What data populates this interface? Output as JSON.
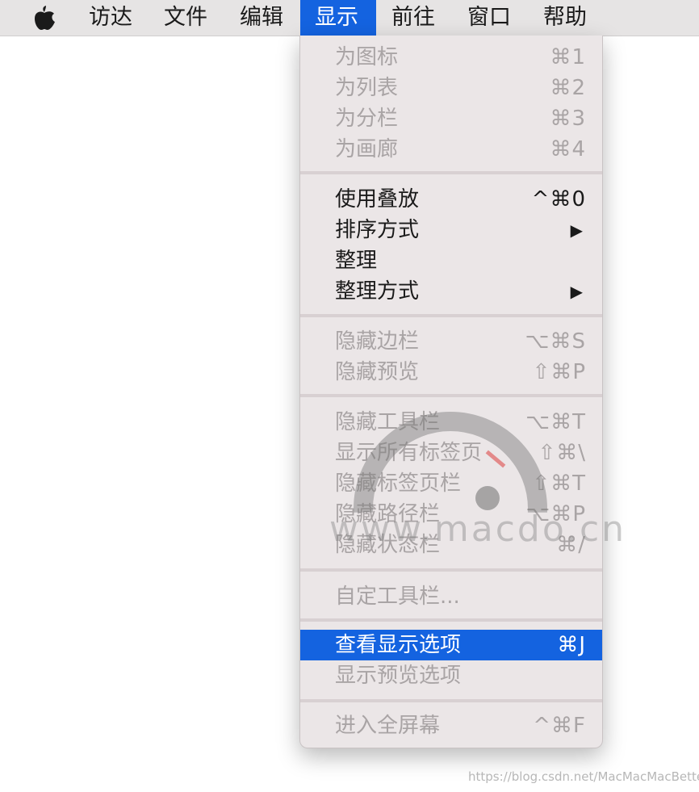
{
  "menubar": {
    "items": [
      "访达",
      "文件",
      "编辑",
      "显示",
      "前往",
      "窗口",
      "帮助"
    ],
    "active_index": 3,
    "active_color": "#1463e0"
  },
  "menu": {
    "items": [
      {
        "label": "为图标",
        "shortcut": "⌘1",
        "enabled": false
      },
      {
        "label": "为列表",
        "shortcut": "⌘2",
        "enabled": false
      },
      {
        "label": "为分栏",
        "shortcut": "⌘3",
        "enabled": false
      },
      {
        "label": "为画廊",
        "shortcut": "⌘4",
        "enabled": false
      },
      {
        "label": "使用叠放",
        "shortcut": "^⌘0",
        "enabled": true
      },
      {
        "label": "排序方式",
        "shortcut": "▶",
        "enabled": true,
        "submenu": true
      },
      {
        "label": "整理",
        "shortcut": "",
        "enabled": true
      },
      {
        "label": "整理方式",
        "shortcut": "▶",
        "enabled": true,
        "submenu": true
      },
      {
        "label": "隐藏边栏",
        "shortcut": "⌥⌘S",
        "enabled": false
      },
      {
        "label": "隐藏预览",
        "shortcut": "⇧⌘P",
        "enabled": false
      },
      {
        "label": "隐藏工具栏",
        "shortcut": "⌥⌘T",
        "enabled": false
      },
      {
        "label": "显示所有标签页",
        "shortcut": "⇧⌘\\",
        "enabled": false
      },
      {
        "label": "隐藏标签页栏",
        "shortcut": "⇧⌘T",
        "enabled": false
      },
      {
        "label": "隐藏路径栏",
        "shortcut": "⌥⌘P",
        "enabled": false
      },
      {
        "label": "隐藏状态栏",
        "shortcut": "⌘/",
        "enabled": false
      },
      {
        "label": "自定工具栏...",
        "shortcut": "",
        "enabled": false
      },
      {
        "label": "查看显示选项",
        "shortcut": "⌘J",
        "enabled": true,
        "highlighted": true
      },
      {
        "label": "显示预览选项",
        "shortcut": "",
        "enabled": false
      },
      {
        "label": "进入全屏幕",
        "shortcut": "^⌘F",
        "enabled": false
      }
    ]
  },
  "watermark": {
    "text": "www.macdo.cn"
  },
  "credit": {
    "text": "https://blog.csdn.net/MacMacMacBetter"
  },
  "icons": {
    "apple": "apple-logo-icon",
    "submenu": "submenu-arrow-icon"
  }
}
